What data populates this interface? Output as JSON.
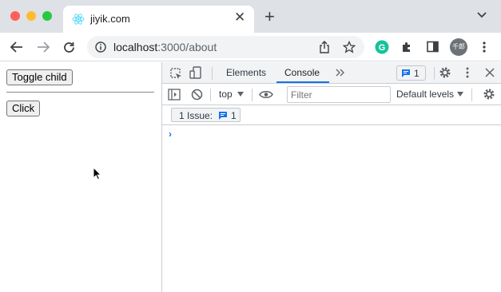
{
  "browser": {
    "tab": {
      "title": "jiyik.com",
      "icon": "react-icon"
    },
    "url": {
      "host": "localhost",
      "path": ":3000/about"
    },
    "avatar_text": "千郎",
    "colors": {
      "close": "#ff5f57",
      "minimize": "#febc2e",
      "maximize": "#28c840",
      "grammarly": "#15c39a"
    }
  },
  "page": {
    "toggle_label": "Toggle child",
    "click_label": "Click"
  },
  "devtools": {
    "tabs": [
      "Elements",
      "Console"
    ],
    "active_tab": "Console",
    "issue_badge_count": "1",
    "context": "top",
    "filter_placeholder": "Filter",
    "levels": "Default levels",
    "issues_label": "1 Issue:",
    "issues_count": "1",
    "prompt_symbol": "›"
  }
}
